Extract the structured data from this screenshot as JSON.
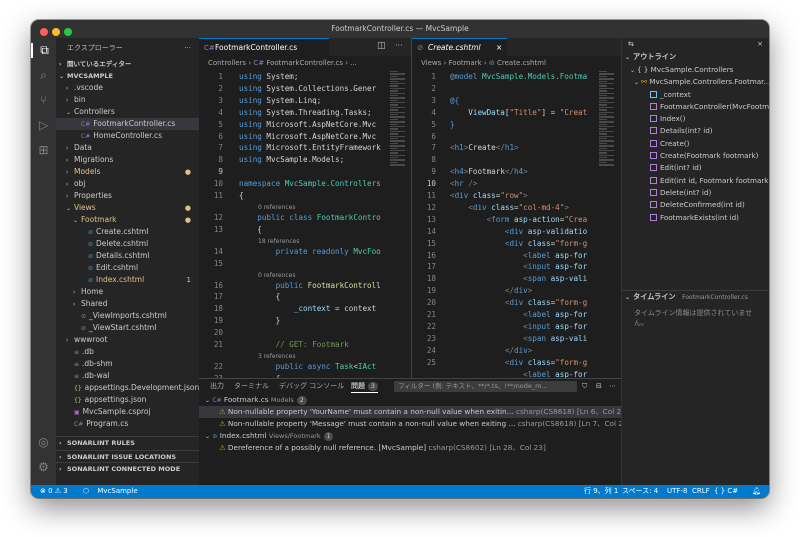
{
  "window": {
    "title": "FootmarkController.cs — MvcSample"
  },
  "explorer": {
    "header": "エクスプローラー",
    "open_editors": "開いているエディター",
    "project": "MVCSAMPLE",
    "items": [
      {
        "label": ".vscode",
        "chev": "›"
      },
      {
        "label": "bin",
        "chev": "›"
      },
      {
        "label": "Controllers",
        "chev": "⌄"
      },
      {
        "label": "FootmarkController.cs",
        "chev": ""
      },
      {
        "label": "HomeController.cs",
        "chev": ""
      },
      {
        "label": "Data",
        "chev": "›"
      },
      {
        "label": "Migrations",
        "chev": "›"
      },
      {
        "label": "Models",
        "chev": "›"
      },
      {
        "label": "obj",
        "chev": "›"
      },
      {
        "label": "Properties",
        "chev": "›"
      },
      {
        "label": "Views",
        "chev": "⌄"
      },
      {
        "label": "Footmark",
        "chev": "⌄"
      },
      {
        "label": "Create.cshtml",
        "chev": ""
      },
      {
        "label": "Delete.cshtml",
        "chev": ""
      },
      {
        "label": "Details.cshtml",
        "chev": ""
      },
      {
        "label": "Edit.cshtml",
        "chev": ""
      },
      {
        "label": "Index.cshtml",
        "chev": "",
        "count": "1"
      },
      {
        "label": "Home",
        "chev": "›"
      },
      {
        "label": "Shared",
        "chev": "›"
      },
      {
        "label": "_ViewImports.cshtml",
        "chev": ""
      },
      {
        "label": "_ViewStart.cshtml",
        "chev": ""
      },
      {
        "label": "wwwroot",
        "chev": "›"
      },
      {
        "label": ".db",
        "chev": ""
      },
      {
        "label": ".db-shm",
        "chev": ""
      },
      {
        "label": ".db-wal",
        "chev": ""
      },
      {
        "label": "appsettings.Development.json",
        "chev": ""
      },
      {
        "label": "appsettings.json",
        "chev": ""
      },
      {
        "label": "MvcSample.csproj",
        "chev": ""
      },
      {
        "label": "Program.cs",
        "chev": ""
      }
    ],
    "sections": [
      "SONARLINT RULES",
      "SONARLINT ISSUE LOCATIONS",
      "SONARLINT CONNECTED MODE"
    ]
  },
  "editor1": {
    "tab": "FootmarkController.cs",
    "breadcrumb": [
      "Controllers",
      "FootmarkController.cs",
      "..."
    ],
    "line_numbers": [
      "1",
      "2",
      "3",
      "4",
      "5",
      "6",
      "7",
      "8",
      "9",
      "10",
      "11",
      "12",
      "13",
      "14",
      "15",
      "16",
      "17",
      "18",
      "19",
      "20",
      "21",
      "22",
      "23"
    ],
    "refs": [
      "0 references",
      "18 references",
      "0 references",
      "3 references"
    ]
  },
  "editor2": {
    "tab": "Create.cshtml",
    "breadcrumb": [
      "Views",
      "Footmark",
      "Create.cshtml"
    ],
    "line_numbers": [
      "1",
      "2",
      "3",
      "4",
      "5",
      "6",
      "7",
      "8",
      "9",
      "10",
      "11",
      "12",
      "13",
      "14",
      "15",
      "16",
      "17",
      "18",
      "19",
      "20",
      "21",
      "22",
      "23",
      "24",
      "25"
    ]
  },
  "outline": {
    "header": "アウトライン",
    "items": [
      "{ } MvcSample.Controllers",
      "MvcSample.Controllers.Footmar...",
      "_context",
      "FootmarkController(MvcFootm...",
      "Index()",
      "Details(int? id)",
      "Create()",
      "Create(Footmark footmark)",
      "Edit(int? id)",
      "Edit(int id, Footmark footmark)",
      "Delete(int? id)",
      "DeleteConfirmed(int id)",
      "FootmarkExists(int id)"
    ],
    "timeline_header": "タイムライン",
    "timeline_file": "FootmarkController.cs",
    "timeline_msg": "タイムライン情報は提供されていません。"
  },
  "panel": {
    "tabs": [
      "出力",
      "ターミナル",
      "デバッグ コンソール",
      "問題"
    ],
    "problems_count": "3",
    "filter_placeholder": "フィルター (例: テキスト、**/*.ts、!**/node_m...",
    "groups": [
      {
        "file": "Footmark.cs",
        "path": "Models",
        "count": "2",
        "items": [
          {
            "msg": "Non-nullable property 'YourName' must contain a non-null value when exitin...",
            "src": "csharp(CS8618)",
            "pos": "[Ln 6、Col 23]"
          },
          {
            "msg": "Non-nullable property 'Message' must contain a non-null value when exiting ...",
            "src": "csharp(CS8618)",
            "pos": "[Ln 7、Col 23]"
          }
        ]
      },
      {
        "file": "Index.cshtml",
        "path": "Views/Footmark",
        "count": "1",
        "items": [
          {
            "msg": "Dereference of a possibly null reference. [MvcSample]",
            "src": "csharp(CS8602)",
            "pos": "[Ln 28、Col 23]"
          }
        ]
      }
    ]
  },
  "statusbar": {
    "errors": "0",
    "warnings": "3",
    "project": "MvcSample",
    "position": "行 9、列 1",
    "spaces": "スペース: 4",
    "encoding": "UTF-8",
    "eol": "CRLF",
    "language": "C#"
  },
  "colors": {
    "accent": "#007acc",
    "warning": "#cca700",
    "modified": "#e2c08d"
  }
}
